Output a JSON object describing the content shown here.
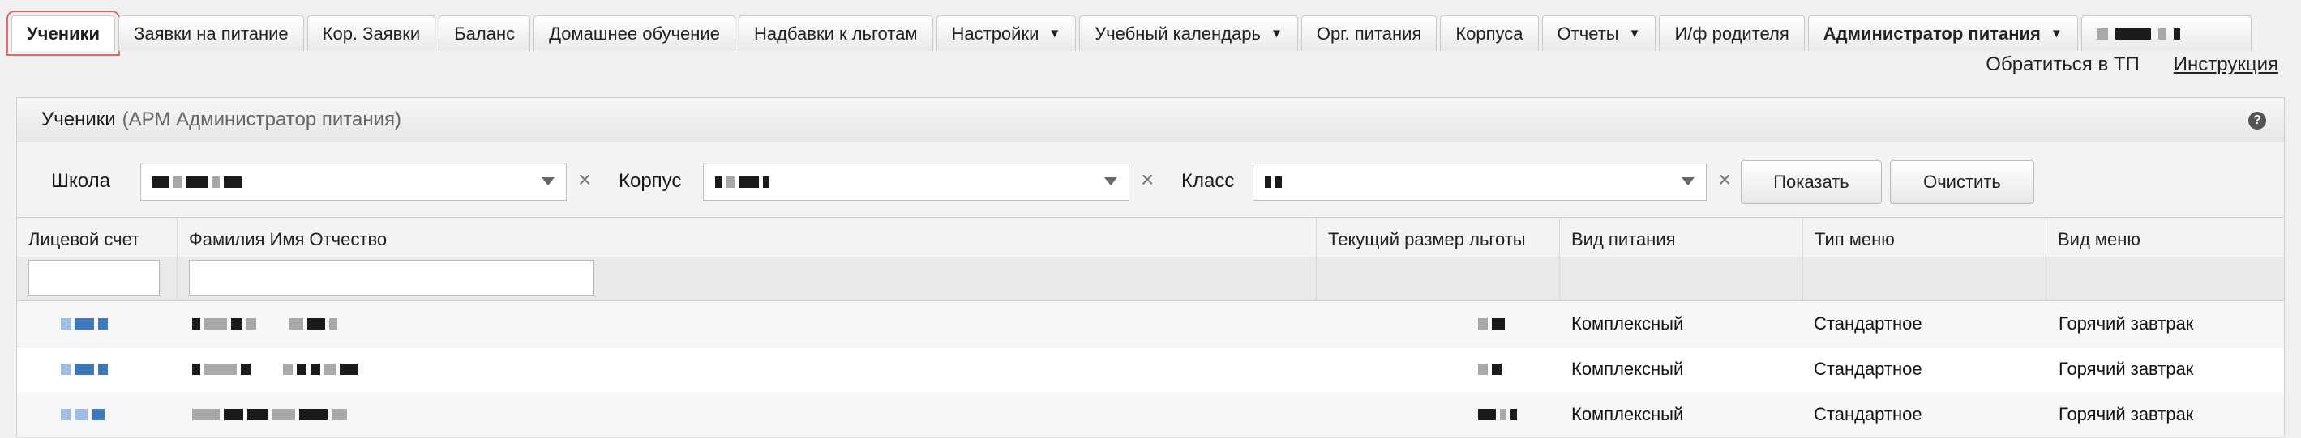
{
  "tabs": [
    {
      "label": "Ученики",
      "active": true,
      "dropdown": false
    },
    {
      "label": "Заявки на питание",
      "dropdown": false
    },
    {
      "label": "Кор. Заявки",
      "dropdown": false
    },
    {
      "label": "Баланс",
      "dropdown": false
    },
    {
      "label": "Домашнее обучение",
      "dropdown": false
    },
    {
      "label": "Надбавки к льготам",
      "dropdown": false
    },
    {
      "label": "Настройки",
      "dropdown": true
    },
    {
      "label": "Учебный календарь",
      "dropdown": true
    },
    {
      "label": "Орг. питания",
      "dropdown": false
    },
    {
      "label": "Корпуса",
      "dropdown": false
    },
    {
      "label": "Отчеты",
      "dropdown": true
    },
    {
      "label": "И/ф родителя",
      "dropdown": false
    },
    {
      "label": "Администратор питания",
      "bold": true,
      "dropdown": true
    }
  ],
  "caret_icon": "▼",
  "top_links": {
    "support": "Обратиться в ТП",
    "manual": "Инструкция"
  },
  "panel": {
    "title": "Ученики",
    "subtitle": "(АРМ Администратор питания)",
    "help_symbol": "?"
  },
  "filters": {
    "school_label": "Школа",
    "building_label": "Корпус",
    "class_label": "Класс",
    "clear_symbol": "×",
    "show_button": "Показать",
    "reset_button": "Очистить"
  },
  "columns": {
    "account": "Лицевой счет",
    "fio": "Фамилия Имя Отчество",
    "benefit": "Текущий размер льготы",
    "meal_type": "Вид питания",
    "menu_type": "Тип меню",
    "menu_kind": "Вид меню"
  },
  "rows": [
    {
      "meal_type": "Комплексный",
      "menu_type": "Стандартное",
      "menu_kind": "Горячий завтрак"
    },
    {
      "meal_type": "Комплексный",
      "menu_type": "Стандартное",
      "menu_kind": "Горячий завтрак"
    },
    {
      "meal_type": "Комплексный",
      "menu_type": "Стандартное",
      "menu_kind": "Горячий завтрак"
    }
  ],
  "colors": {
    "selection_outline": "#e06b6b",
    "account_blue": "#3f78b8"
  }
}
